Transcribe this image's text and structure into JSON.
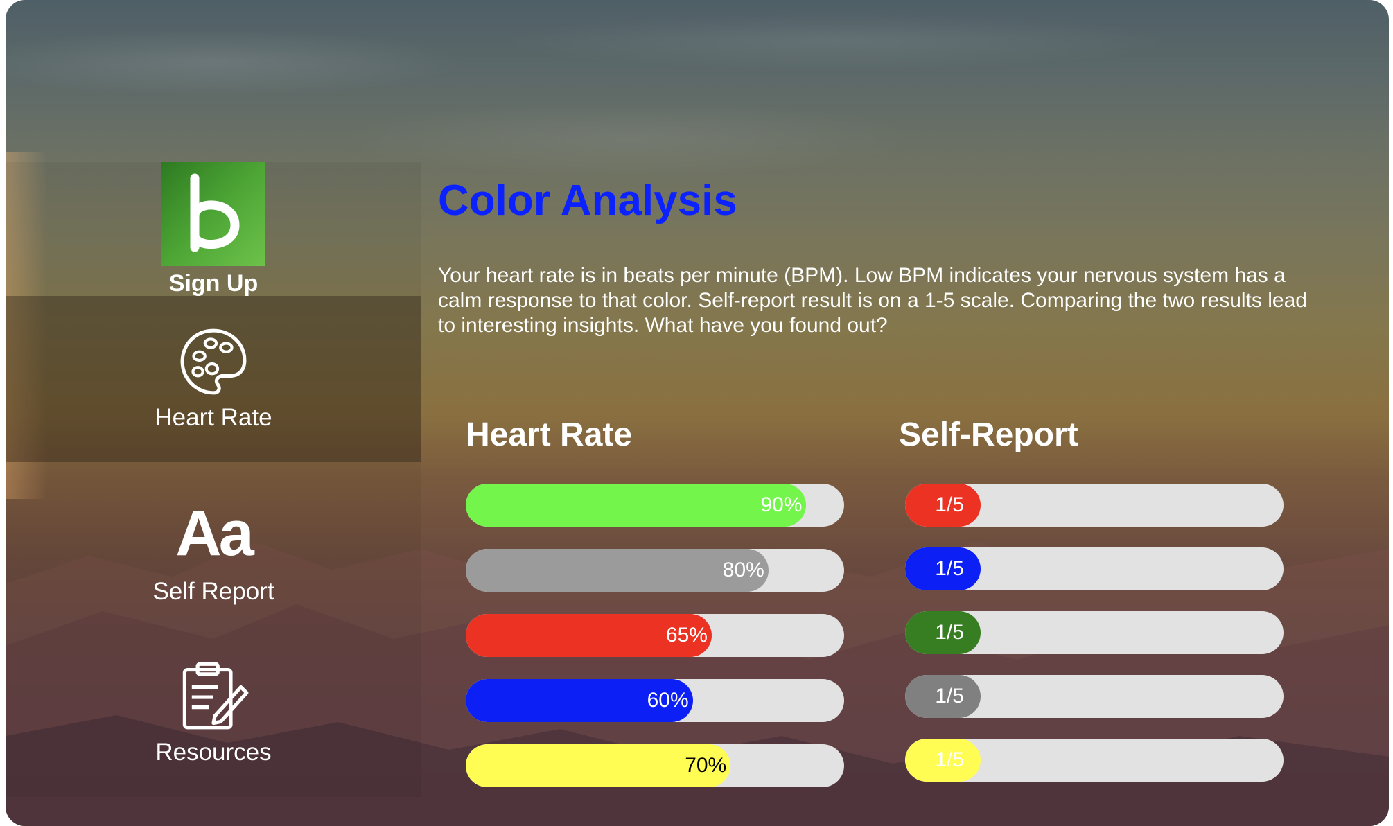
{
  "sidebar": {
    "logo_letter": "b",
    "signup_label": "Sign Up",
    "items": [
      {
        "label": "Heart Rate",
        "icon": "palette-icon",
        "active": true
      },
      {
        "label": "Self Report",
        "icon_text": "Aa",
        "active": false
      },
      {
        "label": "Resources",
        "icon": "clipboard-icon",
        "active": false
      }
    ]
  },
  "main": {
    "title": "Color Analysis",
    "description": "Your heart rate is in beats per minute (BPM). Low BPM indicates your nervous system has a calm response to that color. Self-report result is on a 1-5 scale. Comparing the two results lead to interesting insights. What have you found out?"
  },
  "heart_rate": {
    "title": "Heart Rate",
    "bars": [
      {
        "label": "90%",
        "value": 0.9,
        "color": "#74f54b",
        "text_color": "#ffffff"
      },
      {
        "label": "80%",
        "value": 0.8,
        "color": "#9b9b9b",
        "text_color": "#ffffff"
      },
      {
        "label": "65%",
        "value": 0.65,
        "color": "#eb3223",
        "text_color": "#ffffff"
      },
      {
        "label": "60%",
        "value": 0.6,
        "color": "#0c1ff5",
        "text_color": "#ffffff"
      },
      {
        "label": "70%",
        "value": 0.7,
        "color": "#fffd54",
        "text_color": "#000000"
      }
    ]
  },
  "self_report": {
    "title": "Self-Report",
    "bars": [
      {
        "label": "1/5",
        "value": 0.2,
        "color": "#eb3223"
      },
      {
        "label": "1/5",
        "value": 0.2,
        "color": "#0c1ff5"
      },
      {
        "label": "1/5",
        "value": 0.2,
        "color": "#377d22"
      },
      {
        "label": "1/5",
        "value": 0.2,
        "color": "#808080"
      },
      {
        "label": "1/5",
        "value": 0.2,
        "color": "#fffd54"
      }
    ]
  },
  "colors": {
    "title_blue": "#0b22ff",
    "track": "#e2e2e2"
  }
}
